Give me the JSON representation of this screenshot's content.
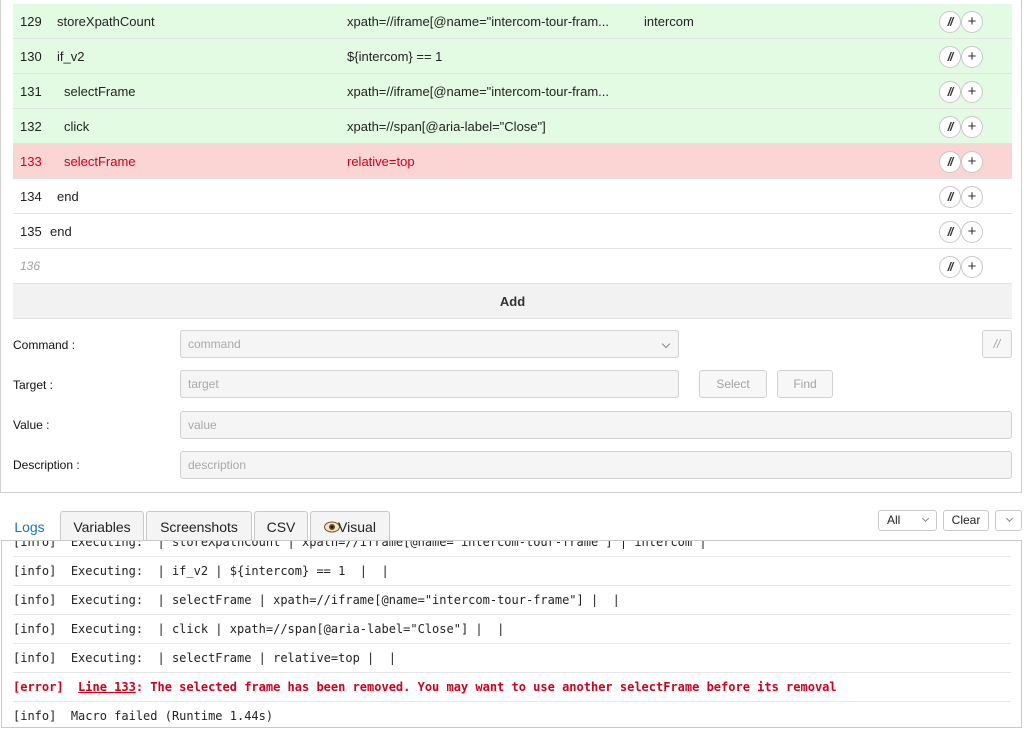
{
  "table": {
    "rows": [
      {
        "num": "129",
        "command": "storeXpathCount",
        "indent": 0,
        "target": "xpath=//iframe[@name=\"intercom-tour-fram...",
        "value": "intercom",
        "status": "green"
      },
      {
        "num": "130",
        "command": "if_v2",
        "indent": 0,
        "target": "${intercom} == 1",
        "value": "",
        "status": "green"
      },
      {
        "num": "131",
        "command": "selectFrame",
        "indent": 1,
        "target": "xpath=//iframe[@name=\"intercom-tour-fram...",
        "value": "",
        "status": "green"
      },
      {
        "num": "132",
        "command": "click",
        "indent": 1,
        "target": "xpath=//span[@aria-label=\"Close\"]",
        "value": "",
        "status": "green"
      },
      {
        "num": "133",
        "command": "selectFrame",
        "indent": 1,
        "target": "relative=top",
        "value": "",
        "status": "red"
      },
      {
        "num": "134",
        "command": "end",
        "indent": 0,
        "target": "",
        "value": "",
        "status": "none"
      },
      {
        "num": "135",
        "command": "end",
        "indent": -1,
        "target": "",
        "value": "",
        "status": "none"
      },
      {
        "num": "136",
        "command": "",
        "indent": 0,
        "target": "",
        "value": "",
        "status": "empty"
      }
    ],
    "comment_button_label": "//",
    "insert_button_label": "+",
    "add_label": "Add"
  },
  "form": {
    "command_label": "Command :",
    "command_placeholder": "command",
    "target_label": "Target :",
    "target_placeholder": "target",
    "value_label": "Value :",
    "value_placeholder": "value",
    "description_label": "Description :",
    "description_placeholder": "description",
    "select_label": "Select",
    "find_label": "Find",
    "comment_label": "//"
  },
  "bottom": {
    "tabs": [
      {
        "label": "Logs",
        "active": true
      },
      {
        "label": "Variables",
        "active": false
      },
      {
        "label": "Screenshots",
        "active": false
      },
      {
        "label": "CSV",
        "active": false
      },
      {
        "label": "Visual",
        "active": false,
        "icon": "eye-icon"
      }
    ],
    "filter_value": "All",
    "clear_label": "Clear"
  },
  "logs": [
    {
      "type": "info",
      "prefix": "[info]",
      "text": "Executing:  | storeXpathCount | xpath=//iframe[@name=\"intercom-tour-frame\"] | intercom |"
    },
    {
      "type": "info",
      "prefix": "[info]",
      "text": "Executing:  | if_v2 | ${intercom} == 1  |  |"
    },
    {
      "type": "info",
      "prefix": "[info]",
      "text": "Executing:  | selectFrame | xpath=//iframe[@name=\"intercom-tour-frame\"] |  |"
    },
    {
      "type": "info",
      "prefix": "[info]",
      "text": "Executing:  | click | xpath=//span[@aria-label=\"Close\"] |  |"
    },
    {
      "type": "info",
      "prefix": "[info]",
      "text": "Executing:  | selectFrame | relative=top |  |"
    },
    {
      "type": "error",
      "prefix": "[error]",
      "link": "Line 133",
      "text": ": The selected frame has been removed. You may want to use another selectFrame before its removal"
    },
    {
      "type": "info",
      "prefix": "[info]",
      "text": "Macro failed (Runtime 1.44s)"
    }
  ],
  "colors": {
    "success_row": "#e3fbe3",
    "error_row": "#fbd4d4",
    "error_text": "#d0021b",
    "active_tab": "#1a73c8"
  }
}
